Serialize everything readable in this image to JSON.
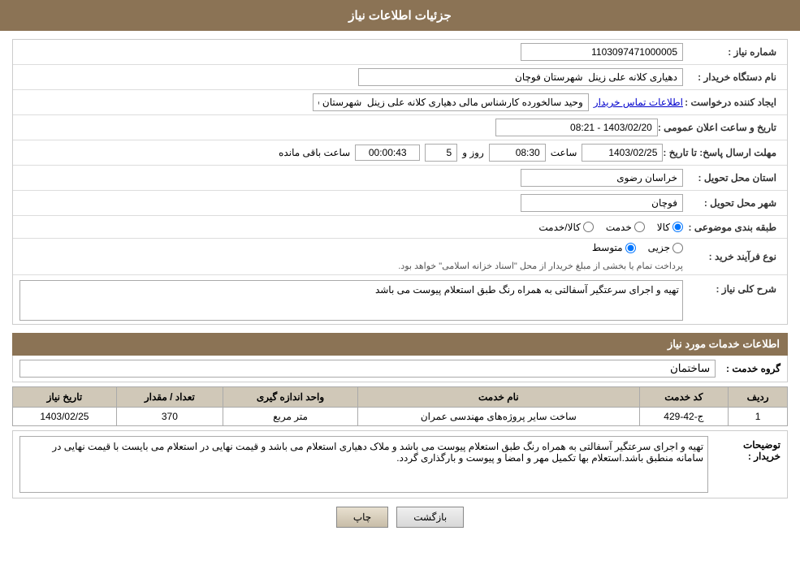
{
  "header": {
    "title": "جزئیات اطلاعات نیاز"
  },
  "fields": {
    "need_number_label": "شماره نیاز :",
    "need_number_value": "1103097471000005",
    "buyer_org_label": "نام دستگاه خریدار :",
    "buyer_org_value": "دهیاری کلانه علی زینل  شهرستان فوچان",
    "creator_label": "ایجاد کننده درخواست :",
    "creator_value": "وحید سالخورده کارشناس مالی دهیاری کلانه علی زینل  شهرستان فوچان",
    "creator_link": "اطلاعات تماس خریدار",
    "announcement_label": "تاریخ و ساعت اعلان عمومی :",
    "announcement_value": "1403/02/20 - 08:21",
    "deadline_label": "مهلت ارسال پاسخ: تا تاریخ :",
    "deadline_date": "1403/02/25",
    "deadline_time": "08:30",
    "deadline_days": "5",
    "deadline_remaining": "00:00:43",
    "deadline_days_label": "روز و",
    "deadline_time_label": "ساعت",
    "deadline_remaining_label": "ساعت باقی مانده",
    "province_label": "استان محل تحویل :",
    "province_value": "خراسان رضوی",
    "city_label": "شهر محل تحویل :",
    "city_value": "فوچان",
    "category_label": "طبقه بندی موضوعی :",
    "category_kala": "کالا",
    "category_khedmat": "خدمت",
    "category_kala_khedmat": "کالا/خدمت",
    "process_label": "نوع فرآیند خرید :",
    "process_jozyi": "جزیی",
    "process_motavaset": "متوسط",
    "process_desc": "پرداخت تمام یا بخشی از مبلغ خریدار از محل \"اسناد خزانه اسلامی\" خواهد بود.",
    "description_label": "شرح کلی نیاز :",
    "description_value": "تهیه و اجرای سرعتگیر آسفالتی به همراه رنگ طبق استعلام پیوست می باشد",
    "services_title": "اطلاعات خدمات مورد نیاز",
    "group_label": "گروه خدمت :",
    "group_value": "ساختمان",
    "table_headers": [
      "ردیف",
      "کد خدمت",
      "نام خدمت",
      "واحد اندازه گیری",
      "تعداد / مقدار",
      "تاریخ نیاز"
    ],
    "table_rows": [
      {
        "row": "1",
        "code": "ج-42-429",
        "name": "ساخت سایر پروژه‌های مهندسی عمران",
        "unit": "متر مربع",
        "quantity": "370",
        "date": "1403/02/25"
      }
    ],
    "buyer_notes_label": "توضیحات خریدار :",
    "buyer_notes_value": "تهیه و اجرای سرعتگیر آسفالتی به همراه رنگ طبق استعلام پیوست می باشد و ملاک دهیاری استعلام می باشد و قیمت نهایی در استعلام می بایست با قیمت نهایی در سامانه منطبق باشد.استعلام بها تکمیل مهر و امضا و پیوست و بارگذاری گردد.",
    "back_button": "بازگشت",
    "print_button": "چاپ"
  }
}
